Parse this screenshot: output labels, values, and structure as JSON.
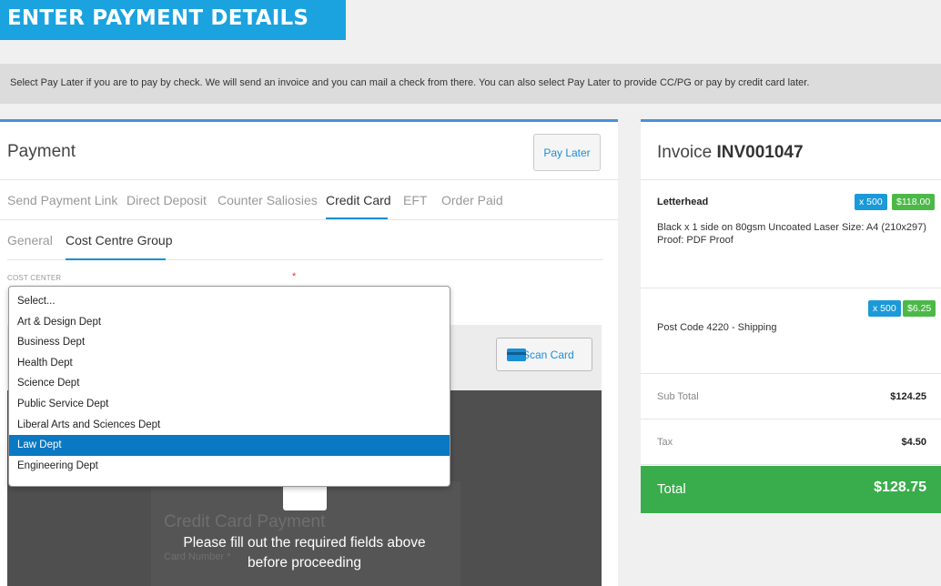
{
  "header": {
    "title": "ENTER PAYMENT DETAILS"
  },
  "notice": "Select Pay Later if you are to pay by check. We will send an invoice and you can mail a check from there. You can also select Pay Later to provide CC/PG or pay by credit card later.",
  "payment": {
    "title": "Payment",
    "pay_later_label": "Pay Later",
    "tabs": [
      "Send Payment Link",
      "Direct Deposit",
      "Counter Saliosies",
      "Credit Card",
      "EFT",
      "Order Paid"
    ],
    "active_tab": "Credit Card",
    "sub_tabs": [
      "General",
      "Cost Centre Group"
    ],
    "active_sub_tab": "Cost Centre Group",
    "cost_center_label": "COST CENTER",
    "required_marker": "*",
    "cost_center_options": [
      "Select...",
      "Art & Design Dept",
      "Business Dept",
      "Health Dept",
      "Science Dept",
      "Public Service Dept",
      "Liberal Arts and Sciences Dept",
      "Law Dept",
      "Engineering Dept"
    ],
    "cost_center_highlighted": "Law Dept",
    "scan_card_label": "Scan Card",
    "card_form_title": "Credit Card Payment",
    "card_number_label": "Card Number *",
    "overlay_line1": "Please fill out the required fields above",
    "overlay_line2": "before proceeding"
  },
  "invoice": {
    "title_prefix": "Invoice",
    "number": "INV001047",
    "items": [
      {
        "name": "Letterhead",
        "qty": "x 500",
        "price": "$118.00",
        "desc_line1": "Black x 1 side on 80gsm Uncoated Laser Size: A4 (210x297)",
        "desc_line2": "Proof: PDF Proof"
      },
      {
        "name": "Post Code 4220 - Shipping",
        "qty": "x 500",
        "price": "$6.25"
      }
    ],
    "sub_total_label": "Sub Total",
    "sub_total": "$124.25",
    "tax_label": "Tax",
    "tax": "$4.50",
    "total_label": "Total",
    "total": "$128.75"
  },
  "colors": {
    "accent_blue": "#1aa3df",
    "link_blue": "#1a8fd6",
    "total_green": "#39ad4b",
    "badge_green": "#4cb848",
    "selected_blue": "#0a78c2"
  },
  "icons": {
    "scan_card": "credit-card-icon"
  }
}
